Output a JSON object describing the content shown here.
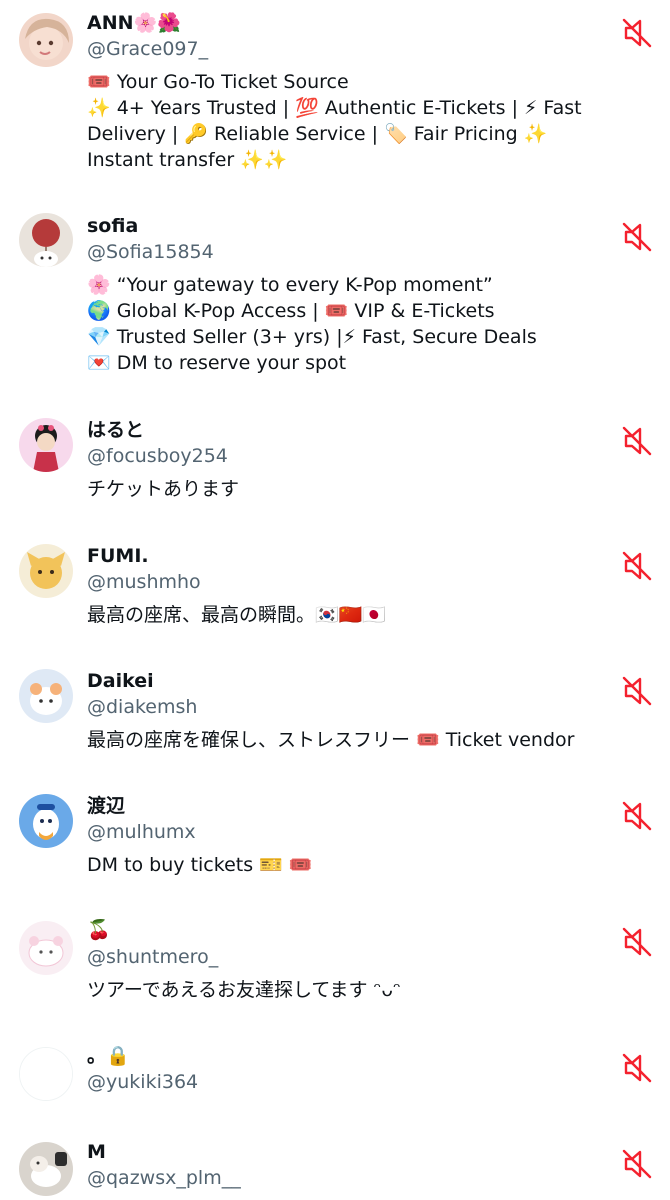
{
  "accounts": [
    {
      "name": "ANN🌸🌺",
      "handle": "@Grace097_",
      "bio": [
        "🎟️ Your Go-To Ticket Source",
        "✨ 4+ Years Trusted | 💯 Authentic E-Tickets | ⚡ Fast",
        "Delivery | 🔑 Reliable Service | 🏷️ Fair Pricing ✨",
        "Instant transfer ✨✨"
      ]
    },
    {
      "name": "sofia",
      "handle": "@Sofia15854",
      "bio": [
        "🌸 “Your gateway to every K-Pop moment”",
        "🌍 Global K-Pop Access | 🎟️ VIP & E-Tickets",
        "💎 Trusted Seller (3+ yrs) |⚡ Fast, Secure Deals",
        "💌 DM to reserve your spot"
      ]
    },
    {
      "name": "はると",
      "handle": "@focusboy254",
      "bio": [
        "チケットあります"
      ]
    },
    {
      "name": "FUMI.",
      "handle": "@mushmho",
      "bio": [
        "最高の座席、最高の瞬間。🇰🇷🇨🇳🇯🇵"
      ]
    },
    {
      "name": "Daikei",
      "handle": "@diakemsh",
      "bio": [
        "最高の座席を確保し、ストレスフリー 🎟️ Ticket vendor"
      ]
    },
    {
      "name": "渡辺",
      "handle": "@mulhumx",
      "bio": [
        "DM to buy tickets 🎫 🎟️"
      ]
    },
    {
      "name": "🍒",
      "handle": "@shuntmero_",
      "bio": [
        "ツアーであえるお友達探してます ᵔᴗᵔ"
      ]
    },
    {
      "name": "。🔒",
      "handle": "@yukiki364",
      "bio": []
    },
    {
      "name": "M",
      "handle": "@qazwsx_plm__",
      "bio": []
    }
  ],
  "colors": {
    "name_text": "#0f1419",
    "handle_text": "#536471",
    "mute_icon": "#f4212e"
  },
  "icons": {
    "row_action": "speaker-muted-icon"
  }
}
